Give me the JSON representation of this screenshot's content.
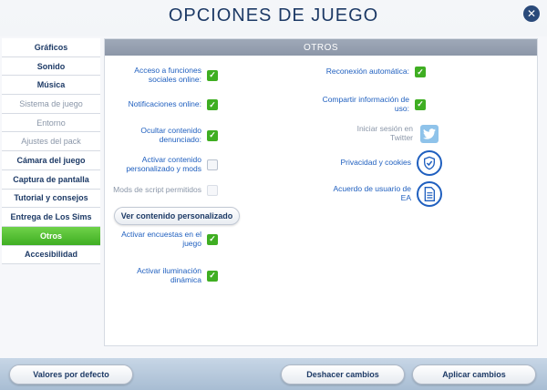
{
  "window": {
    "title": "OPCIONES DE JUEGO",
    "close_label": "✕"
  },
  "sidebar": {
    "items": [
      {
        "label": "Gráficos",
        "state": "normal"
      },
      {
        "label": "Sonido",
        "state": "normal"
      },
      {
        "label": "Música",
        "state": "normal"
      },
      {
        "label": "Sistema de juego",
        "state": "disabled"
      },
      {
        "label": "Entorno",
        "state": "disabled"
      },
      {
        "label": "Ajustes del pack",
        "state": "disabled"
      },
      {
        "label": "Cámara del juego",
        "state": "normal"
      },
      {
        "label": "Captura de pantalla",
        "state": "normal"
      },
      {
        "label": "Tutorial y consejos",
        "state": "normal"
      },
      {
        "label": "Entrega de Los Sims",
        "state": "normal"
      },
      {
        "label": "Otros",
        "state": "active"
      },
      {
        "label": "Accesibilidad",
        "state": "normal"
      }
    ]
  },
  "content": {
    "header": "OTROS",
    "left_options": {
      "social": {
        "label": "Acceso a funciones sociales online:",
        "checked": true
      },
      "notifications": {
        "label": "Notificaciones online:",
        "checked": true
      },
      "hide_reported": {
        "label": "Ocultar contenido denunciado:",
        "checked": true
      },
      "custom_content": {
        "label": "Activar contenido personalizado y mods",
        "checked": false
      },
      "script_mods": {
        "label": "Mods de script permitidos",
        "checked": false,
        "disabled": true
      },
      "view_custom_button": "Ver contenido personalizado",
      "surveys": {
        "label": "Activar encuestas en el juego",
        "checked": true
      },
      "dynamic_lighting": {
        "label": "Activar iluminación dinámica",
        "checked": true
      }
    },
    "right_options": {
      "auto_reconnect": {
        "label": "Reconexión automática:",
        "checked": true
      },
      "share_usage": {
        "label": "Compartir información de uso:",
        "checked": true
      },
      "twitter": {
        "label": "Iniciar sesión en Twitter"
      },
      "privacy": {
        "label": "Privacidad y cookies"
      },
      "ea_agreement": {
        "label": "Acuerdo de usuario de EA"
      }
    }
  },
  "footer": {
    "defaults": "Valores por defecto",
    "undo": "Deshacer cambios",
    "apply": "Aplicar cambios"
  },
  "colors": {
    "accent_green": "#3fae22",
    "link_blue": "#1f5fbf",
    "title_navy": "#1d3a66",
    "twitter_blue": "#8fc3ea"
  }
}
